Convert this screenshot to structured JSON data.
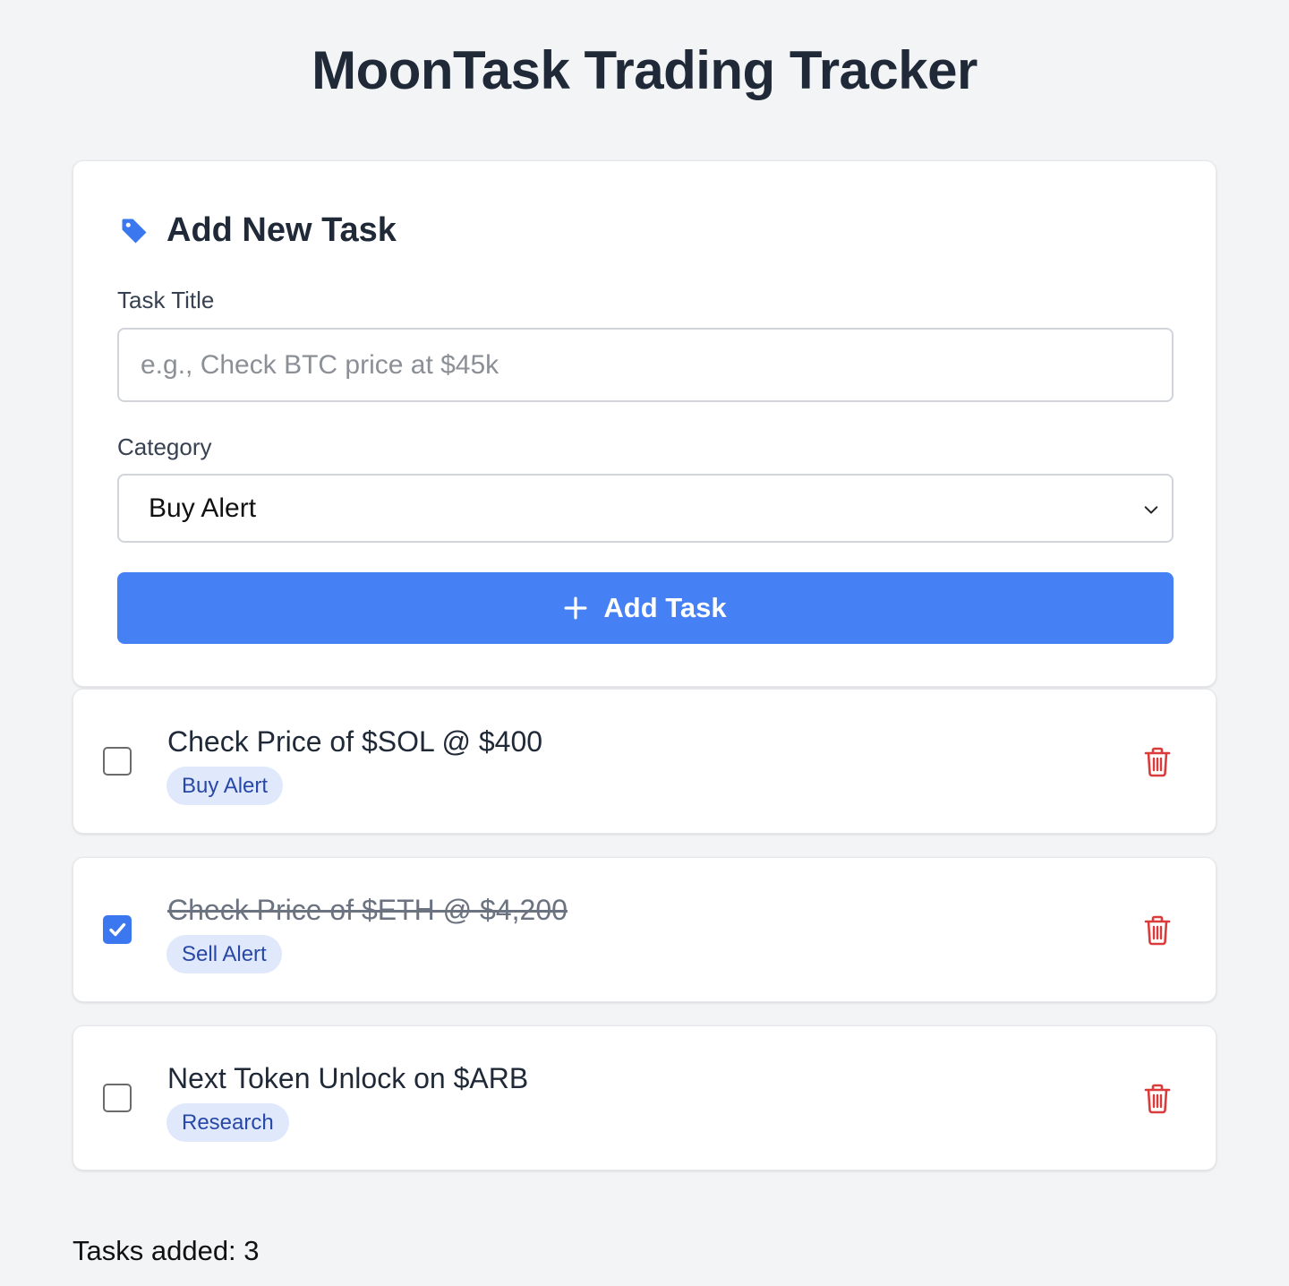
{
  "app": {
    "title": "MoonTask Trading Tracker"
  },
  "form": {
    "heading": "Add New Task",
    "heading_icon": "tag-icon",
    "title_label": "Task Title",
    "title_placeholder": "e.g., Check BTC price at $45k",
    "title_value": "",
    "category_label": "Category",
    "category_selected": "Buy Alert",
    "add_button_label": "Add Task",
    "accent_color": "#4580f5"
  },
  "tasks": [
    {
      "title": "Check Price of $SOL @ $400",
      "category": "Buy Alert",
      "completed": false
    },
    {
      "title": "Check Price of $ETH @ $4,200",
      "category": "Sell Alert",
      "completed": true
    },
    {
      "title": "Next Token Unlock on $ARB",
      "category": "Research",
      "completed": false
    }
  ],
  "footer": {
    "tasks_added_text": "Tasks added: 3"
  },
  "colors": {
    "delete": "#dc3b3b",
    "badge_bg": "#e0e9fb",
    "badge_text": "#2848a8"
  }
}
